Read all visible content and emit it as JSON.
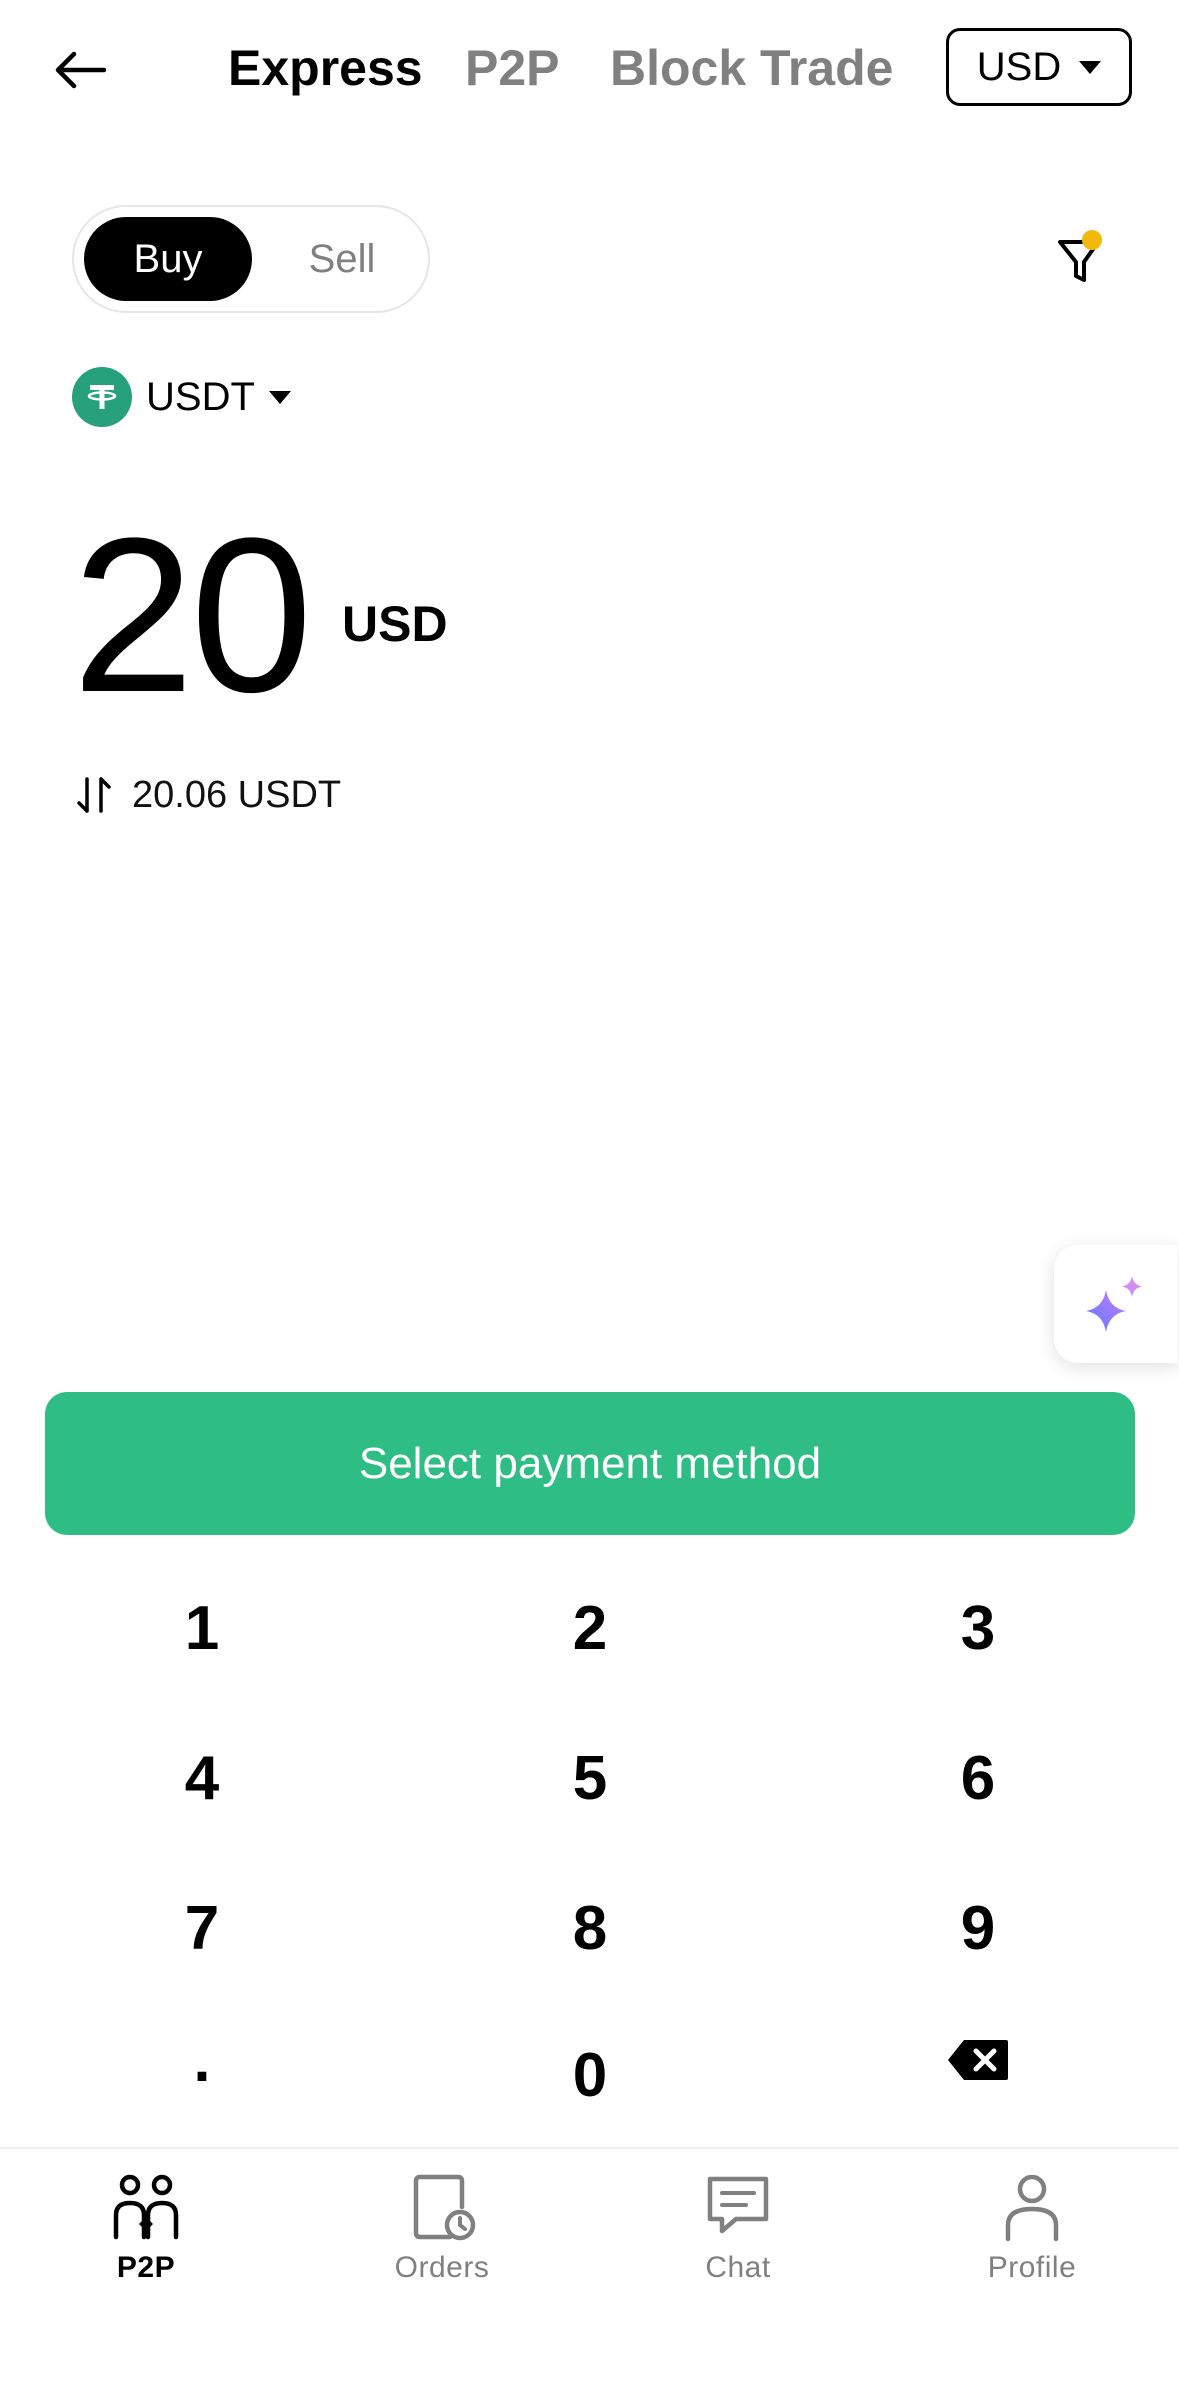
{
  "header": {
    "back_icon": "arrow-left-icon",
    "tabs": [
      {
        "label": "Express",
        "active": true
      },
      {
        "label": "P2P",
        "active": false
      },
      {
        "label": "Block Trade",
        "active": false
      }
    ],
    "currency": "USD"
  },
  "trade": {
    "buy_label": "Buy",
    "sell_label": "Sell",
    "mode": "Buy",
    "asset": "USDT",
    "filter_icon": "filter-icon",
    "filter_badge_color": "#f0b90b"
  },
  "amount": {
    "value": "20",
    "unit": "USD",
    "converted": "20.06 USDT"
  },
  "cta": {
    "label": "Select payment method",
    "color": "#2ebd85"
  },
  "keypad": {
    "keys": [
      "1",
      "2",
      "3",
      "4",
      "5",
      "6",
      "7",
      "8",
      "9",
      ".",
      "0"
    ],
    "backspace_icon": "backspace-icon"
  },
  "nav": {
    "items": [
      {
        "label": "P2P",
        "icon": "p2p-users-icon",
        "active": true
      },
      {
        "label": "Orders",
        "icon": "orders-clock-icon",
        "active": false
      },
      {
        "label": "Chat",
        "icon": "chat-bubble-icon",
        "active": false
      },
      {
        "label": "Profile",
        "icon": "profile-person-icon",
        "active": false
      }
    ]
  }
}
